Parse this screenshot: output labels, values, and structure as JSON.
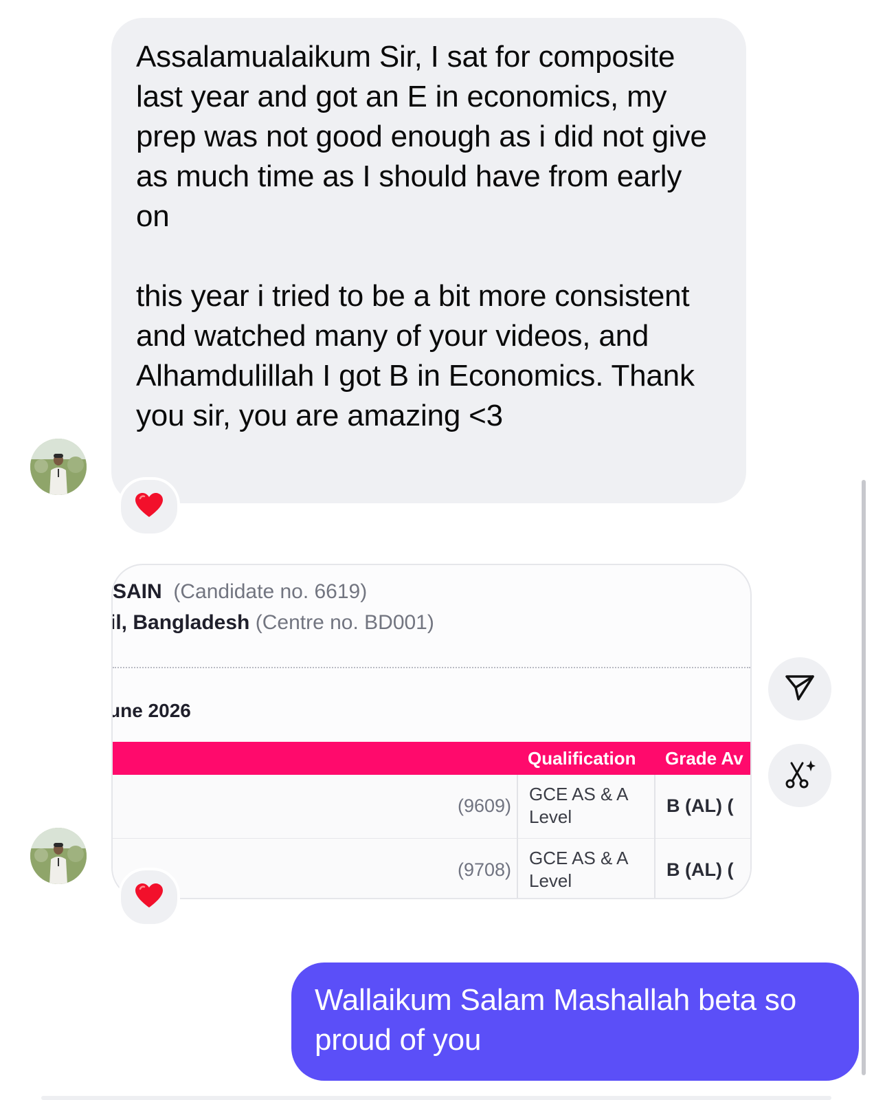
{
  "messages": {
    "incoming_text": {
      "paragraph_1": "Assalamualaikum Sir, I sat for composite last year and got an E in economics, my prep was not good enough as i did not give as much time as I should have from early on",
      "paragraph_2": "this year i tried to be a bit more consistent and watched many of your videos, and Alhamdulillah I got B in Economics. Thank you sir, you are amazing <3",
      "reaction": "❤️"
    },
    "incoming_image": {
      "candidate_name": "SAIN",
      "candidate_no": "(Candidate no. 6619)",
      "centre_name": "il, Bangladesh",
      "centre_no": "(Centre no. BD001)",
      "session": "une 2026",
      "table": {
        "headers": [
          "Qualification",
          "Grade Av"
        ],
        "rows": [
          {
            "code": "(9609)",
            "qualification": "GCE AS & A Level",
            "grade": "B (AL) ("
          },
          {
            "code": "(9708)",
            "qualification": "GCE AS & A Level",
            "grade": "B (AL) ("
          }
        ]
      },
      "reaction": "❤️"
    },
    "outgoing_text": "Wallaikum Salam Mashallah beta so proud of you"
  },
  "side_actions": {
    "share_icon": "send-icon",
    "ai_edit_icon": "scissors-sparkle-icon"
  },
  "colors": {
    "incoming_bubble": "#eff0f3",
    "outgoing_bubble": "#5b4ff8",
    "table_header": "#ff0a6c"
  }
}
